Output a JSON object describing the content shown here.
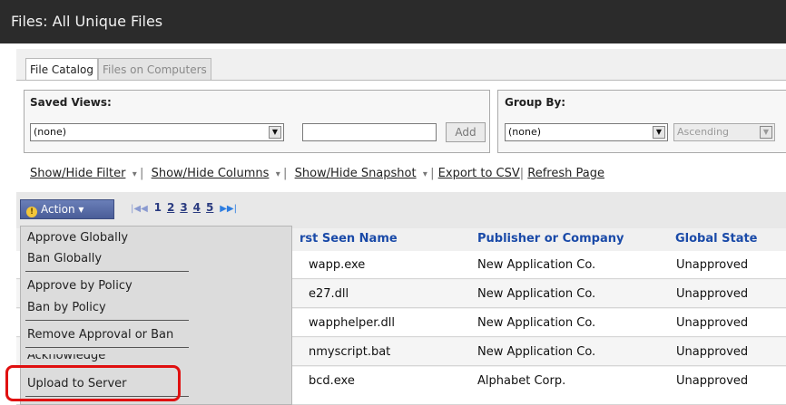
{
  "window": {
    "title": "Files: All Unique Files"
  },
  "tabs": [
    {
      "label": "File Catalog",
      "active": true
    },
    {
      "label": "Files on Computers",
      "active": false
    }
  ],
  "saved_views": {
    "label": "Saved Views:",
    "selected": "(none)",
    "name_value": "",
    "add_label": "Add"
  },
  "group_by": {
    "label": "Group By:",
    "selected": "(none)",
    "order_selected": "Ascending"
  },
  "links": {
    "show_hide_filter": "Show/Hide Filter",
    "show_hide_columns": "Show/Hide Columns",
    "show_hide_snapshot": "Show/Hide Snapshot",
    "export_csv": "Export to CSV",
    "refresh_page": "Refresh Page"
  },
  "toolbar": {
    "action_label": "Action",
    "pages": [
      "1",
      "2",
      "3",
      "4",
      "5"
    ],
    "current_page": "1"
  },
  "table": {
    "columns": [
      "rst Seen Name",
      "Publisher or Company",
      "Global State"
    ],
    "rows": [
      [
        "wapp.exe",
        "New Application Co.",
        "Unapproved"
      ],
      [
        "e27.dll",
        "New Application Co.",
        "Unapproved"
      ],
      [
        "wapphelper.dll",
        "New Application Co.",
        "Unapproved"
      ],
      [
        "nmyscript.bat",
        "New Application Co.",
        "Unapproved"
      ],
      [
        "bcd.exe",
        "Alphabet Corp.",
        "Unapproved"
      ]
    ]
  },
  "action_menu": {
    "items": [
      "Approve Globally",
      "Ban Globally",
      "Approve by Policy",
      "Ban by Policy",
      "Remove Approval or Ban",
      "Acknowledge",
      "Upload to Server"
    ]
  },
  "colors": {
    "accent": "#1a4aa8",
    "highlight": "#e01010",
    "title_bg": "#2b2b2b"
  }
}
